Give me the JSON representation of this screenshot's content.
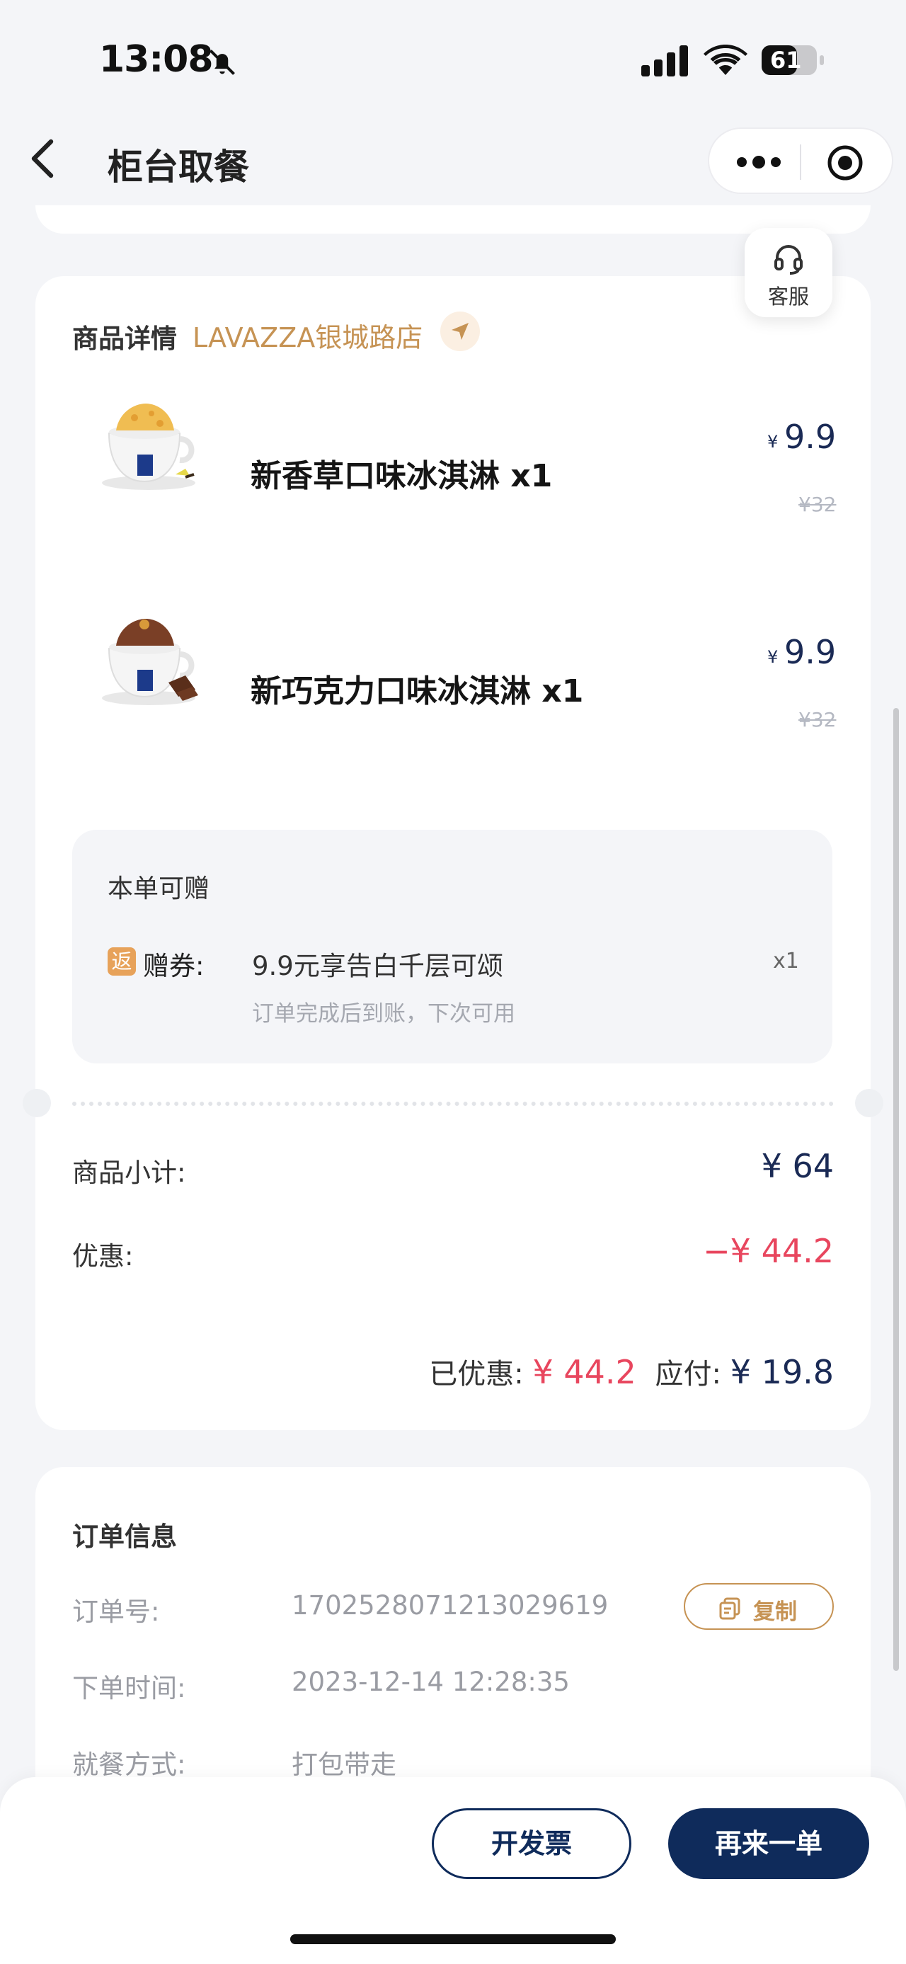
{
  "status_bar": {
    "time": "13:08",
    "battery": "61",
    "icons": [
      "bell-slash-icon",
      "signal-icon",
      "wifi-icon",
      "battery-icon"
    ]
  },
  "nav": {
    "title": "柜台取餐",
    "icons": [
      "back-chevron-icon",
      "more-dots-icon",
      "record-target-icon"
    ]
  },
  "customer_service": {
    "label": "客服",
    "icon": "headset-icon"
  },
  "product_section": {
    "title": "商品详情",
    "store": "LAVAZZA银城路店",
    "store_icon": "location-arrow-icon"
  },
  "products": [
    {
      "name": "新香草口味冰淇淋 x1",
      "currency": "¥",
      "price": "9.9",
      "original_price": "¥32",
      "image": "vanilla-ice-cream-cup"
    },
    {
      "name": "新巧克力口味冰淇淋 x1",
      "currency": "¥",
      "price": "9.9",
      "original_price": "¥32",
      "image": "chocolate-ice-cream-cup"
    }
  ],
  "gift": {
    "title": "本单可赠",
    "badge": "返",
    "label": "赠券:",
    "name": "9.9元享告白千层可颂",
    "qty": "x1",
    "note": "订单完成后到账，下次可用"
  },
  "totals": {
    "subtotal_label": "商品小计:",
    "subtotal_value": "¥ 64",
    "discount_label": "优惠:",
    "discount_value": "−¥ 44.2",
    "saved_label": "已优惠:",
    "saved_value": "¥ 44.2",
    "payable_label": "应付:",
    "payable_value": "¥ 19.8"
  },
  "order_info": {
    "title": "订单信息",
    "order_no_label": "订单号:",
    "order_no": "1702528071213029619",
    "copy_label": "复制",
    "time_label": "下单时间:",
    "time": "2023-12-14 12:28:35",
    "dining_label": "就餐方式:",
    "dining": "打包带走"
  },
  "actions": {
    "invoice": "开发票",
    "reorder": "再来一单"
  },
  "colors": {
    "brand_navy": "#0f2b5b",
    "accent_gold": "#c69354",
    "discount_red": "#e8465e",
    "background": "#f4f5f8"
  }
}
